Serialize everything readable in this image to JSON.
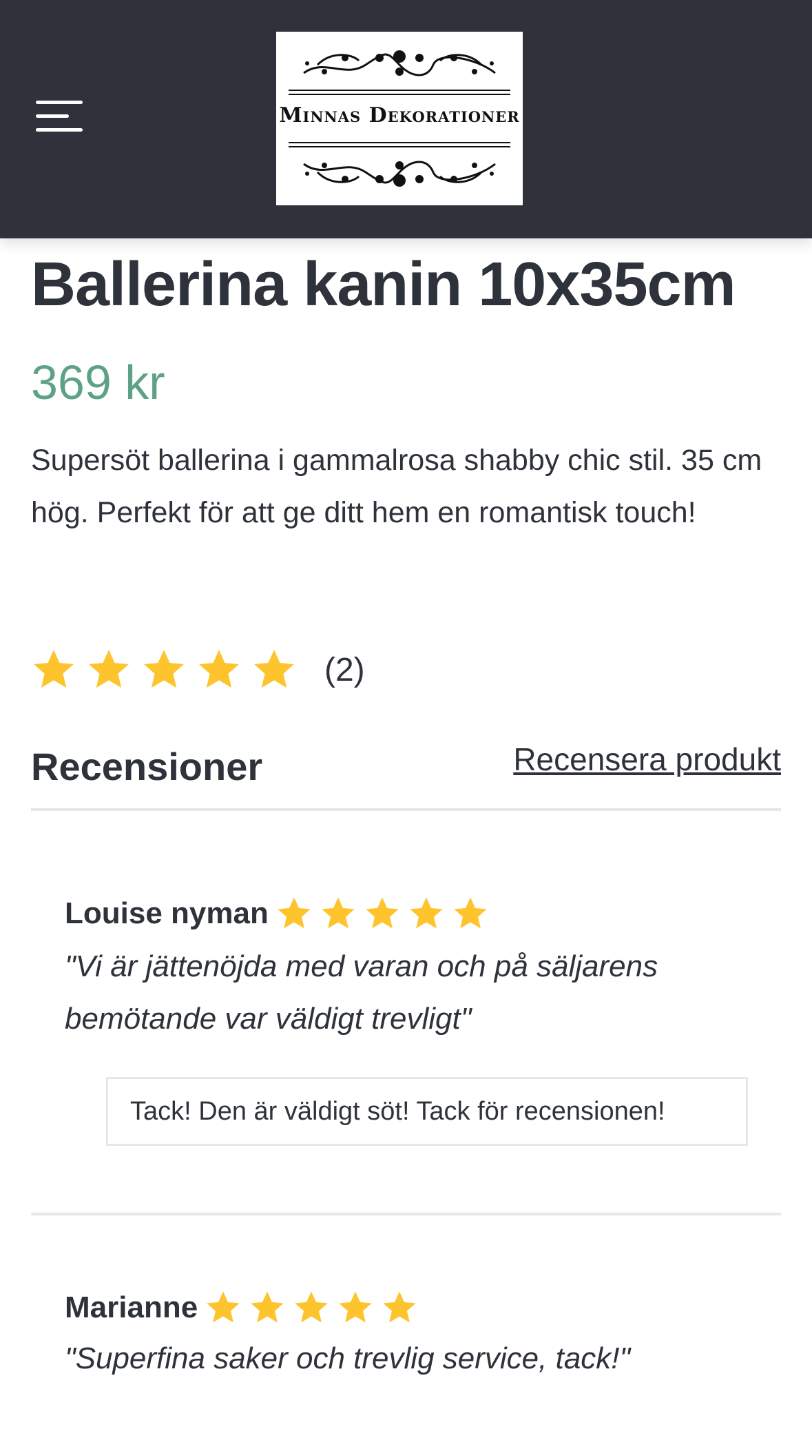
{
  "header": {
    "menu_icon": "hamburger-menu-icon",
    "logo_text": "Minnas Dekorationer",
    "background": "#2f323a"
  },
  "product": {
    "title": "Ballerina kanin 10x35cm",
    "price": "369 kr",
    "description": "Supersöt ballerina i gammalrosa shabby chic stil. 35 cm hög. Perfekt för att ge ditt hem en romantisk touch!",
    "rating_stars": 5,
    "rating_count": "(2)",
    "price_color": "#5ea284",
    "star_color": "#fdc42d"
  },
  "reviews": {
    "heading": "Recensioner",
    "write_review_label": "Recensera produkt",
    "items": [
      {
        "author": "Louise nyman",
        "stars": 5,
        "text": "\"Vi är jättenöjda med varan och på säljarens bemötande var väldigt trevligt\"",
        "reply": "Tack! Den är väldigt söt! Tack för recensionen!"
      },
      {
        "author": "Marianne",
        "stars": 5,
        "text": "\"Superfina saker och trevlig service, tack!\""
      }
    ]
  }
}
